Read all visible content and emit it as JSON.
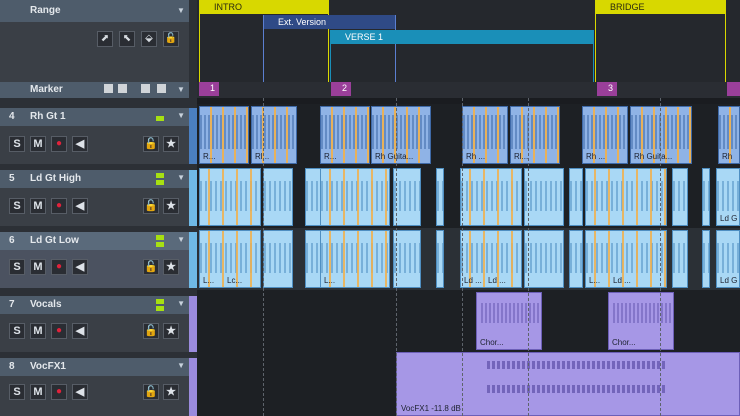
{
  "range_header": {
    "label": "Range"
  },
  "marker_header": {
    "label": "Marker"
  },
  "arrangement": [
    {
      "label": "INTRO",
      "color": "#d8d800"
    },
    {
      "label": "Ext. Version",
      "color": "#2f4a86"
    },
    {
      "label": "VERSE 1",
      "color": "#1a8fb8"
    },
    {
      "label": "BRIDGE",
      "color": "#d8d800"
    }
  ],
  "markers": [
    "1",
    "2",
    "3"
  ],
  "tracks": [
    {
      "number": "4",
      "name": "Rh Gt 1",
      "mute": "M",
      "solo": "S"
    },
    {
      "number": "5",
      "name": "Ld Gt High",
      "mute": "M",
      "solo": "S"
    },
    {
      "number": "6",
      "name": "Ld Gt Low",
      "mute": "M",
      "solo": "S"
    },
    {
      "number": "7",
      "name": "Vocals",
      "mute": "M",
      "solo": "S"
    },
    {
      "number": "8",
      "name": "VocFX1",
      "mute": "M",
      "solo": "S"
    }
  ],
  "clips": {
    "rh": [
      "R...",
      "Rl...",
      "R...",
      "Rh Guita...",
      "Rh ...",
      "Rl...",
      "Rh ...",
      "Rh Guita...",
      "Rh"
    ],
    "ldhigh": [
      "Ld G"
    ],
    "ldlow": [
      "L...",
      "Lc...",
      "L...",
      "Ld ...",
      "Ld ...",
      "L...",
      "Ld ...",
      "Ld G"
    ],
    "vocals": [
      "Chor...",
      "Chor..."
    ],
    "vocfx": [
      "VocFX1 -11.8 dB"
    ]
  }
}
